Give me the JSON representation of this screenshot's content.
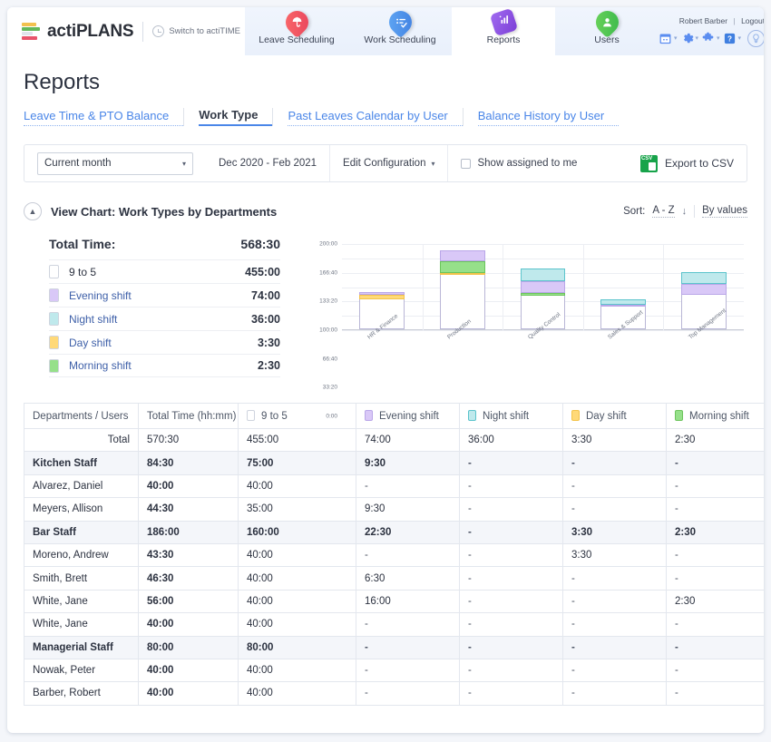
{
  "brand": {
    "name": "actiPLANS",
    "switch_label": "Switch to actiTIME"
  },
  "nav": [
    {
      "label": "Leave Scheduling",
      "icon": "umbrella-pin-icon",
      "active": false
    },
    {
      "label": "Work Scheduling",
      "icon": "checklist-pin-icon",
      "active": false
    },
    {
      "label": "Reports",
      "icon": "bar-chart-square-icon",
      "active": true
    },
    {
      "label": "Users",
      "icon": "user-pin-icon",
      "active": false
    }
  ],
  "account": {
    "user": "Robert Barber",
    "separator": "|",
    "logout": "Logout"
  },
  "header_icons": [
    "calendar-icon",
    "gear-icon",
    "puzzle-icon",
    "help-icon",
    "lightbulb-icon"
  ],
  "page": {
    "title": "Reports"
  },
  "subtabs": [
    {
      "label": "Leave Time & PTO Balance",
      "active": false
    },
    {
      "label": "Work Type",
      "active": true
    },
    {
      "label": "Past Leaves Calendar by User",
      "active": false
    },
    {
      "label": "Balance History by User",
      "active": false
    }
  ],
  "filters": {
    "period_value": "Current month",
    "date_range": "Dec 2020  -  Feb 2021",
    "edit_configuration": "Edit Configuration",
    "show_assigned_label": "Show assigned to me",
    "show_assigned_checked": false,
    "export_label": "Export to CSV"
  },
  "chart_section": {
    "title": "View Chart: Work Types by Departments",
    "sort_label": "Sort:",
    "sort_az": "A - Z",
    "sort_by_values": "By values"
  },
  "summary": {
    "total_label": "Total Time:",
    "total_value": "568:30",
    "items": [
      {
        "label": "9 to 5",
        "value": "455:00",
        "color": "#ffffff"
      },
      {
        "label": "Evening shift",
        "value": "74:00",
        "color": "#d9c8f7"
      },
      {
        "label": "Night shift",
        "value": "36:00",
        "color": "#bfe9ec"
      },
      {
        "label": "Day shift",
        "value": "3:30",
        "color": "#ffd978"
      },
      {
        "label": "Morning shift",
        "value": "2:30",
        "color": "#96e08a"
      }
    ]
  },
  "chart_data": {
    "type": "bar",
    "stacked": true,
    "title": "Work Types by Departments",
    "xlabel": "",
    "ylabel": "",
    "ylim": [
      0,
      200
    ],
    "grid": true,
    "legend_position": "left-panel",
    "ytick_labels": [
      "0:00",
      "33:20",
      "66:40",
      "100:00",
      "133:20",
      "166:40",
      "200:00"
    ],
    "ytick_values": [
      0,
      33.33,
      66.67,
      100,
      133.33,
      166.67,
      200
    ],
    "categories": [
      "HR & Finance",
      "Production",
      "Quality Control",
      "Sales & Support",
      "Top Management"
    ],
    "series": [
      {
        "name": "9 to 5",
        "color": "#ffffff",
        "values": [
          70,
          126,
          78,
          52,
          80
        ]
      },
      {
        "name": "Day shift",
        "color": "#ffd978",
        "values": [
          9,
          3.5,
          0,
          0,
          0
        ]
      },
      {
        "name": "Morning shift",
        "color": "#96e08a",
        "values": [
          0,
          28,
          7,
          0,
          0
        ]
      },
      {
        "name": "Evening shift",
        "color": "#d9c8f7",
        "values": [
          7,
          25,
          27,
          5,
          26
        ]
      },
      {
        "name": "Night shift",
        "color": "#bfe9ec",
        "values": [
          0,
          0,
          30,
          12,
          27
        ]
      }
    ]
  },
  "table": {
    "headers": [
      {
        "label": "Departments / Users",
        "color": null
      },
      {
        "label": "Total Time (hh:mm)",
        "color": null
      },
      {
        "label": "9 to 5",
        "color": "#ffffff"
      },
      {
        "label": "Evening shift",
        "color": "#d9c8f7"
      },
      {
        "label": "Night shift",
        "color": "#bfe9ec"
      },
      {
        "label": "Day shift",
        "color": "#ffd978"
      },
      {
        "label": "Morning shift",
        "color": "#96e08a"
      }
    ],
    "rows": [
      {
        "type": "total",
        "cells": [
          "Total",
          "570:30",
          "455:00",
          "74:00",
          "36:00",
          "3:30",
          "2:30"
        ]
      },
      {
        "type": "dept",
        "cells": [
          "Kitchen Staff",
          "84:30",
          "75:00",
          "9:30",
          "-",
          "-",
          "-"
        ]
      },
      {
        "type": "user",
        "cells": [
          "Alvarez, Daniel",
          "40:00",
          "40:00",
          "-",
          "-",
          "-",
          "-"
        ]
      },
      {
        "type": "user",
        "cells": [
          "Meyers, Allison",
          "44:30",
          "35:00",
          "9:30",
          "-",
          "-",
          "-"
        ]
      },
      {
        "type": "dept",
        "cells": [
          "Bar Staff",
          "186:00",
          "160:00",
          "22:30",
          "-",
          "3:30",
          "2:30"
        ]
      },
      {
        "type": "user",
        "cells": [
          "Moreno, Andrew",
          "43:30",
          "40:00",
          "-",
          "-",
          "3:30",
          "-"
        ]
      },
      {
        "type": "user",
        "cells": [
          "Smith, Brett",
          "46:30",
          "40:00",
          "6:30",
          "-",
          "-",
          "-"
        ]
      },
      {
        "type": "user",
        "cells": [
          "White, Jane",
          "56:00",
          "40:00",
          "16:00",
          "-",
          "-",
          "2:30"
        ]
      },
      {
        "type": "user",
        "cells": [
          "White, Jane",
          "40:00",
          "40:00",
          "-",
          "-",
          "-",
          "-"
        ]
      },
      {
        "type": "dept",
        "cells": [
          "Managerial Staff",
          "80:00",
          "80:00",
          "-",
          "-",
          "-",
          "-"
        ]
      },
      {
        "type": "user",
        "cells": [
          "Nowak, Peter",
          "40:00",
          "40:00",
          "-",
          "-",
          "-",
          "-"
        ]
      },
      {
        "type": "user",
        "cells": [
          "Barber, Robert",
          "40:00",
          "40:00",
          "-",
          "-",
          "-",
          "-"
        ]
      }
    ]
  }
}
